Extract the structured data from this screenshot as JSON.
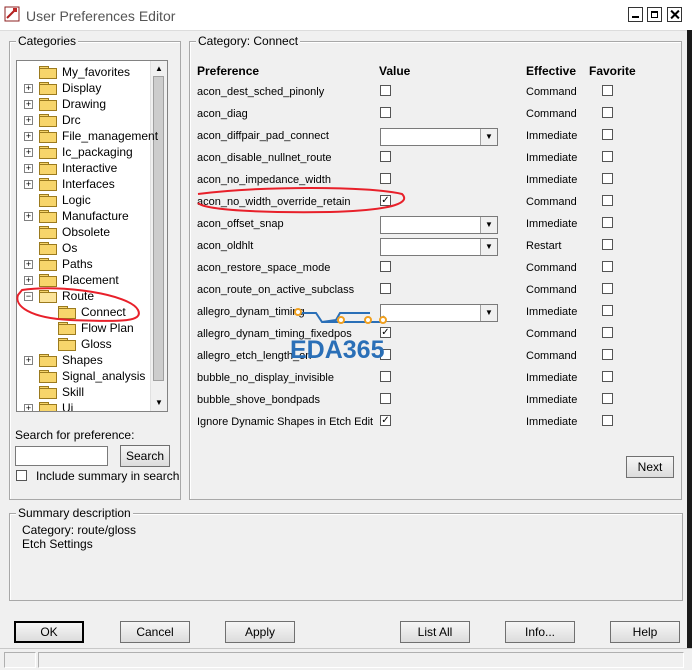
{
  "window": {
    "title": "User Preferences Editor"
  },
  "categories": {
    "label": "Categories",
    "tree": [
      {
        "label": "My_favorites",
        "expander": "",
        "open": false
      },
      {
        "label": "Display",
        "expander": "+",
        "open": false
      },
      {
        "label": "Drawing",
        "expander": "+",
        "open": false
      },
      {
        "label": "Drc",
        "expander": "+",
        "open": false
      },
      {
        "label": "File_management",
        "expander": "+",
        "open": false
      },
      {
        "label": "Ic_packaging",
        "expander": "+",
        "open": false
      },
      {
        "label": "Interactive",
        "expander": "+",
        "open": false
      },
      {
        "label": "Interfaces",
        "expander": "+",
        "open": false
      },
      {
        "label": "Logic",
        "expander": "",
        "open": false
      },
      {
        "label": "Manufacture",
        "expander": "+",
        "open": false
      },
      {
        "label": "Obsolete",
        "expander": "",
        "open": false
      },
      {
        "label": "Os",
        "expander": "",
        "open": false
      },
      {
        "label": "Paths",
        "expander": "+",
        "open": false
      },
      {
        "label": "Placement",
        "expander": "+",
        "open": false
      },
      {
        "label": "Route",
        "expander": "−",
        "open": true
      },
      {
        "label": "Connect",
        "expander": "",
        "open": false,
        "child": true
      },
      {
        "label": "Flow Plan",
        "expander": "",
        "open": false,
        "child": true
      },
      {
        "label": "Gloss",
        "expander": "",
        "open": false,
        "child": true
      },
      {
        "label": "Shapes",
        "expander": "+",
        "open": false
      },
      {
        "label": "Signal_analysis",
        "expander": "",
        "open": false
      },
      {
        "label": "Skill",
        "expander": "",
        "open": false
      },
      {
        "label": "Ui",
        "expander": "+",
        "open": false
      }
    ],
    "search_label": "Search for preference:",
    "search_value": "",
    "search_button": "Search",
    "include_summary_label": "Include summary in search"
  },
  "category_panel": {
    "label": "Category:  Connect",
    "headers": {
      "preference": "Preference",
      "value": "Value",
      "effective": "Effective",
      "favorite": "Favorite"
    },
    "rows": [
      {
        "name": "acon_dest_sched_pinonly",
        "control": "check",
        "checked": false,
        "effective": "Command"
      },
      {
        "name": "acon_diag",
        "control": "check",
        "checked": false,
        "effective": "Command"
      },
      {
        "name": "acon_diffpair_pad_connect",
        "control": "select",
        "checked": false,
        "effective": "Immediate"
      },
      {
        "name": "acon_disable_nullnet_route",
        "control": "check",
        "checked": false,
        "effective": "Immediate"
      },
      {
        "name": "acon_no_impedance_width",
        "control": "check",
        "checked": false,
        "effective": "Immediate"
      },
      {
        "name": "acon_no_width_override_retain",
        "control": "check",
        "checked": true,
        "effective": "Command"
      },
      {
        "name": "acon_offset_snap",
        "control": "select",
        "checked": false,
        "effective": "Immediate"
      },
      {
        "name": "acon_oldhlt",
        "control": "select",
        "checked": false,
        "effective": "Restart"
      },
      {
        "name": "acon_restore_space_mode",
        "control": "check",
        "checked": false,
        "effective": "Command"
      },
      {
        "name": "acon_route_on_active_subclass",
        "control": "check",
        "checked": false,
        "effective": "Command"
      },
      {
        "name": "allegro_dynam_timing",
        "control": "select",
        "checked": false,
        "effective": "Immediate"
      },
      {
        "name": "allegro_dynam_timing_fixedpos",
        "control": "check",
        "checked": true,
        "effective": "Command"
      },
      {
        "name": "allegro_etch_length_on",
        "control": "check",
        "checked": false,
        "effective": "Command"
      },
      {
        "name": "bubble_no_display_invisible",
        "control": "check",
        "checked": false,
        "effective": "Immediate"
      },
      {
        "name": "bubble_shove_bondpads",
        "control": "check",
        "checked": false,
        "effective": "Immediate"
      },
      {
        "name": "Ignore Dynamic Shapes in Etch Edit",
        "control": "check",
        "checked": true,
        "effective": "Immediate"
      }
    ],
    "next_button": "Next"
  },
  "summary": {
    "label": "Summary description",
    "category_line": "Category: route/gloss",
    "description": "Etch Settings"
  },
  "buttons": {
    "ok": "OK",
    "cancel": "Cancel",
    "apply": "Apply",
    "list_all": "List All",
    "info": "Info...",
    "help": "Help"
  },
  "watermark": {
    "text": "EDA365"
  },
  "colors": {
    "annotation": "#e8202a",
    "watermark": "#2a6fb7",
    "watermark_dots": "#f0a020"
  }
}
